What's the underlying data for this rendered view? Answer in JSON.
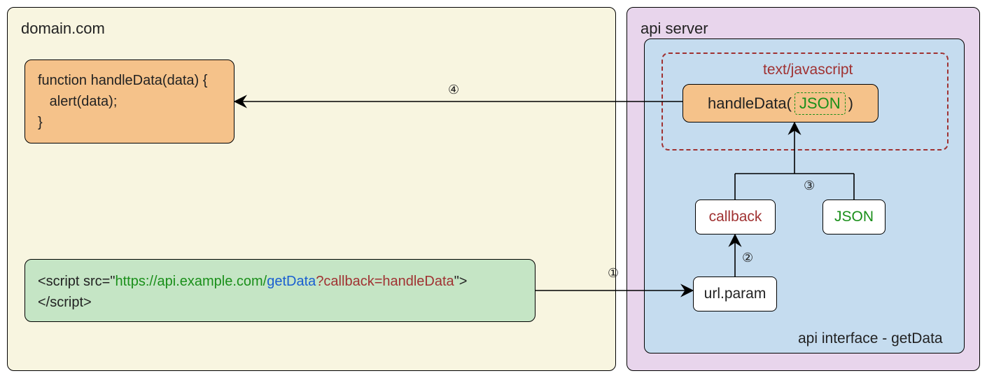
{
  "domain_box": {
    "title": "domain.com"
  },
  "function_box": {
    "line1": "function handleData(data) {",
    "line2": "   alert(data);",
    "line3": "}"
  },
  "script_box": {
    "prefix": "<script src=\"",
    "url_base": "https://api.example.com/",
    "url_method": "getData",
    "url_query": "?callback=handleData",
    "suffix": "\">",
    "closing": "</script>"
  },
  "api_box": {
    "title": "api server"
  },
  "interface_box": {
    "title": "api interface - getData"
  },
  "response_box": {
    "header": "text/javascript",
    "call_prefix": "handleData(",
    "json_token": "JSON",
    "call_suffix": ")"
  },
  "callback_box": {
    "label": "callback"
  },
  "json_box": {
    "label": "JSON"
  },
  "urlparam_box": {
    "label": "url.param"
  },
  "steps": {
    "s1": "①",
    "s2": "②",
    "s3": "③",
    "s4": "④"
  }
}
